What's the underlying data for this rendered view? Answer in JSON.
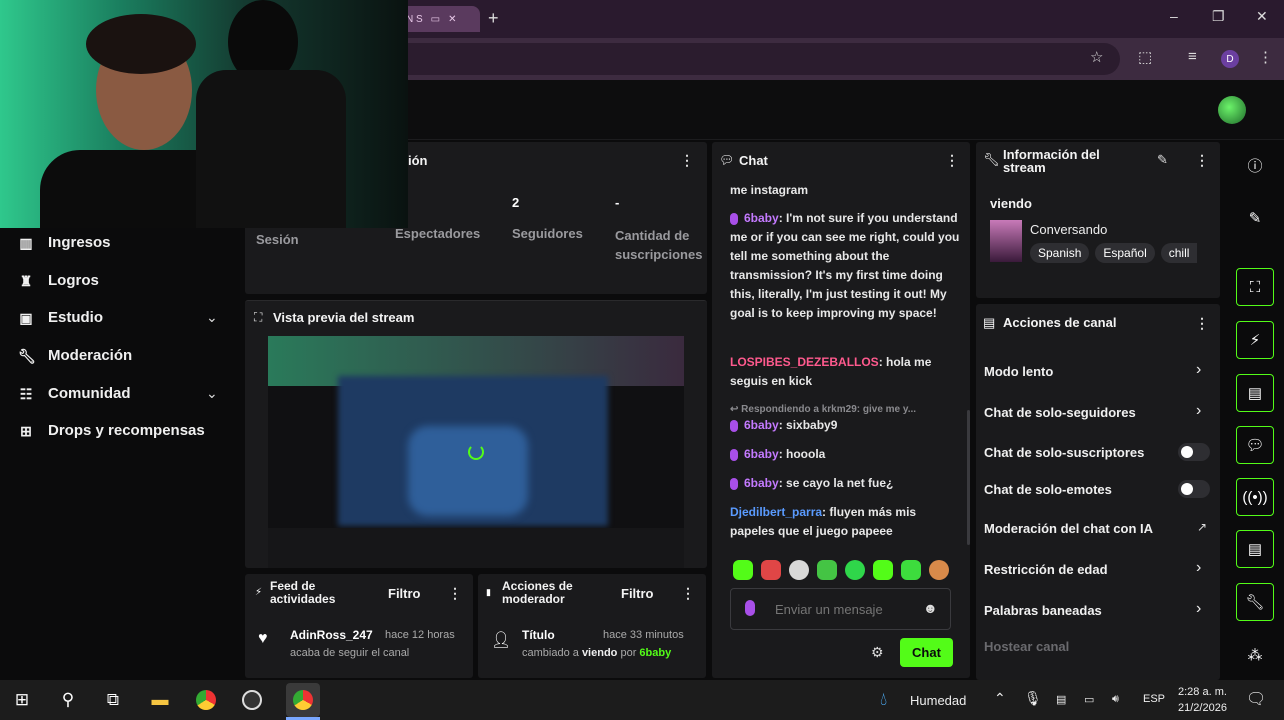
{
  "browser": {
    "tab_label": "N S",
    "new_tab": "+",
    "window_controls": [
      "–",
      "❐",
      "✕"
    ],
    "profile_initial": "D"
  },
  "sidebar": {
    "items": [
      {
        "label": "Ingresos",
        "icon": "bar-chart-icon"
      },
      {
        "label": "Logros",
        "icon": "trophy-icon"
      },
      {
        "label": "Estudio",
        "icon": "studio-icon",
        "expandable": true
      },
      {
        "label": "Moderación",
        "icon": "wrench-icon"
      },
      {
        "label": "Comunidad",
        "icon": "community-icon",
        "expandable": true
      },
      {
        "label": "Drops y recompensas",
        "icon": "drops-icon"
      }
    ]
  },
  "session_panel": {
    "title_fragment": "ión",
    "stats": [
      {
        "value": "",
        "label": "Sesión"
      },
      {
        "value": "",
        "label": "Espectadores"
      },
      {
        "value": "2",
        "label": "Seguidores"
      },
      {
        "value": "-",
        "label": "Cantidad de suscripciones"
      }
    ]
  },
  "preview": {
    "title": "Vista previa del stream"
  },
  "chat": {
    "title": "Chat",
    "messages": [
      {
        "user": "",
        "text": "me instagram",
        "color": "none"
      },
      {
        "user": "6baby",
        "text": ": I'm not sure if you understand me or if you can see me right, could you tell me something about the transmission? It's my first time doing this, literally, I'm just testing it out! My goal is to keep improving my space!",
        "color": "purple",
        "badge": true
      },
      {
        "user": "LOSPIBES_DEZEBALLOS",
        "text": ": hola me seguis en kick",
        "color": "red"
      },
      {
        "reply": "Respondiendo a krkm29: give me y..."
      },
      {
        "user": "6baby",
        "text": ": sixbaby9",
        "color": "purple",
        "badge": true
      },
      {
        "user": "6baby",
        "text": ": hooola",
        "color": "purple",
        "badge": true
      },
      {
        "user": "6baby",
        "text": ": se cayo la net fue¿",
        "color": "purple",
        "badge": true
      },
      {
        "user": "Djedilbert_parra",
        "text": ": fluyen más mis papeles que el juego papeee",
        "color": "blue"
      }
    ],
    "input_placeholder": "Enviar un mensaje",
    "send_label": "Chat"
  },
  "stream_info": {
    "title": "Información del stream",
    "viewing": "viendo",
    "category": "Conversando",
    "tags": [
      "Spanish",
      "Español",
      "chill"
    ]
  },
  "channel_actions": {
    "title": "Acciones de canal",
    "items": [
      {
        "label": "Modo lento",
        "control": "arrow"
      },
      {
        "label": "Chat de solo-seguidores",
        "control": "arrow"
      },
      {
        "label": "Chat de solo-suscriptores",
        "control": "toggle"
      },
      {
        "label": "Chat de solo-emotes",
        "control": "toggle"
      },
      {
        "label": "Moderación del chat con IA",
        "control": "external"
      },
      {
        "label": "Restricción de edad",
        "control": "arrow"
      },
      {
        "label": "Palabras baneadas",
        "control": "arrow"
      },
      {
        "label": "Hostear canal",
        "control": "none"
      }
    ]
  },
  "activity_feed": {
    "title": "Feed de actividades",
    "filter": "Filtro",
    "entry": {
      "user": "AdinRoss_247",
      "time": "hace 12 horas",
      "text": "acaba de seguir el canal"
    }
  },
  "mod_actions": {
    "title": "Acciones de moderador",
    "filter": "Filtro",
    "entry": {
      "label": "Título",
      "time": "hace 33 minutos",
      "pre": "cambiado a",
      "value": "viendo",
      "by": "por",
      "user": "6baby"
    }
  },
  "taskbar": {
    "weather": "Humedad",
    "lang": "ESP",
    "time": "2:28 a. m.",
    "date": "21/2/2026"
  },
  "colors": {
    "accent": "#53fc18",
    "panel": "#1a1a1c",
    "purple_user": "#c47aff"
  }
}
